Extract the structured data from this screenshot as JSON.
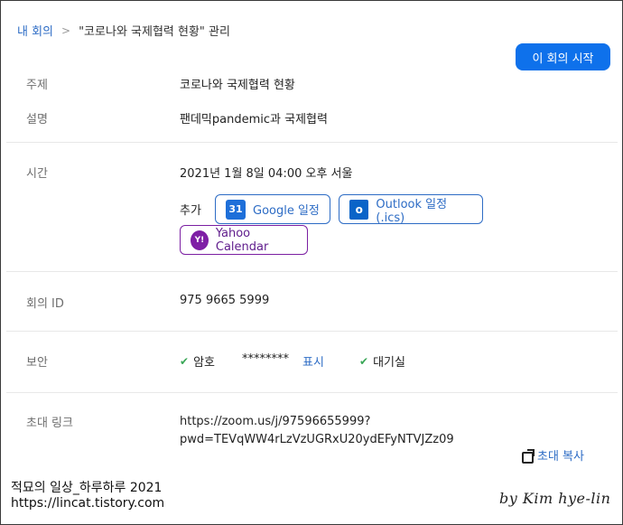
{
  "breadcrumb": {
    "parent": "내 회의",
    "separator": ">",
    "current": "\"코로나와 국제협력 현황\" 관리"
  },
  "start_button": "이 회의 시작",
  "topic": {
    "label": "주제",
    "value": "코로나와 국제협력 현황"
  },
  "description": {
    "label": "설명",
    "value": "팬데믹pandemic과 국제협력"
  },
  "time": {
    "label": "시간",
    "value": "2021년 1월 8일 04:00 오후 서울",
    "add_label": "추가",
    "calendars": [
      {
        "icon": "google-calendar-icon",
        "icon_text": "31",
        "label": "Google 일정"
      },
      {
        "icon": "outlook-icon",
        "icon_text": "o",
        "label": "Outlook 일정(.ics)"
      },
      {
        "icon": "yahoo-icon",
        "icon_text": "Y!",
        "label": "Yahoo Calendar"
      }
    ]
  },
  "meeting_id": {
    "label": "회의 ID",
    "value": "975 9665 5999"
  },
  "security": {
    "label": "보안",
    "password_label": "암호",
    "password_mask": "********",
    "show_label": "표시",
    "waiting_room_label": "대기실",
    "check_color": "#3aa757"
  },
  "invite": {
    "label": "초대 링크",
    "line1": "https://zoom.us/j/97596655999?",
    "line2": "pwd=TEVqWW4rLzVzUGRxU20ydEFyNTVJZz09",
    "copy_label": "초대 복사"
  },
  "watermark": {
    "line1": "적묘의 일상_하루하루 2021",
    "line2": "https://lincat.tistory.com",
    "signature": "by Kim hye-lin"
  },
  "colors": {
    "accent": "#0e71eb",
    "link": "#2d6cc5",
    "yahoo": "#7e1fa5"
  }
}
